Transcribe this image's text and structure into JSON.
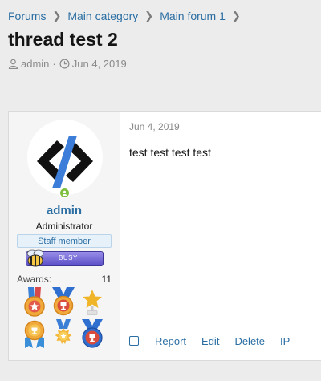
{
  "breadcrumb": [
    "Forums",
    "Main category",
    "Main forum 1"
  ],
  "page_title": "thread test 2",
  "meta": {
    "author": "admin",
    "date": "Jun 4, 2019"
  },
  "user": {
    "name": "admin",
    "title": "Administrator",
    "banner": "Staff member",
    "status_badge": "BUSY",
    "awards_label": "Awards:",
    "awards_count": "11"
  },
  "post": {
    "date": "Jun 4, 2019",
    "message": "test test test test",
    "actions": [
      "Report",
      "Edit",
      "Delete",
      "IP"
    ]
  },
  "colors": {
    "link": "#2b6ea3",
    "online": "#7fbf3f",
    "busy": "#5b4ec7"
  }
}
